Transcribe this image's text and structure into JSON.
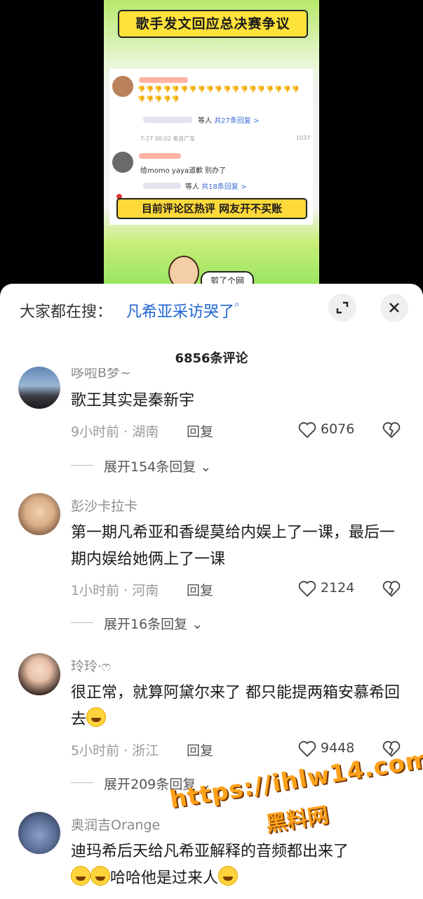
{
  "video": {
    "banner_title": "歌手发文回应总决赛争议",
    "card": {
      "c1_reply_others": "等人",
      "c1_reply_count": "共27条回复 >",
      "c1_time": "7-27 00:02 来自广东",
      "c1_likes": "1037",
      "c2_text": "给momo yaya道歉 别办了",
      "c2_reply_others": "等人",
      "c2_reply_count": "共18条回复 >"
    },
    "bottom_banner": "目前评论区热评 网友开不买账",
    "bubble_text": "剪了个网"
  },
  "search": {
    "label": "大家都在搜：",
    "term": "凡希亚采访哭了",
    "search_glyph": "⌕"
  },
  "comments_count": "6856条评论",
  "comments": [
    {
      "name": "哆啦B梦~",
      "text": "歌王其实是秦新宇",
      "meta": "9小时前 · 湖南",
      "reply": "回复",
      "likes": "6076",
      "expand": "展开154条回复"
    },
    {
      "name": "彭沙卡拉卡",
      "text": "第一期凡希亚和香缇莫给内娱上了一课，最后一期内娱给她俩上了一课",
      "meta": "1小时前 · 河南",
      "reply": "回复",
      "likes": "2124",
      "expand": "展开16条回复"
    },
    {
      "name": "玲玲·ෆ",
      "text": "很正常，就算阿黛尔来了 都只能提两箱安慕希回去",
      "meta": "5小时前 · 浙江",
      "reply": "回复",
      "likes": "9448",
      "expand": "展开209条回复"
    },
    {
      "name": "奥润吉Orange",
      "text_a": "迪玛希后天给凡希亚解释的音频都出来了",
      "text_b": "哈哈他是过来人"
    }
  ],
  "watermark": {
    "url": "https://ihlw14.com",
    "site": "黑料网"
  },
  "colors": {
    "accent_blue": "#1f64d4",
    "watermark_orange": "#ffa21a"
  }
}
